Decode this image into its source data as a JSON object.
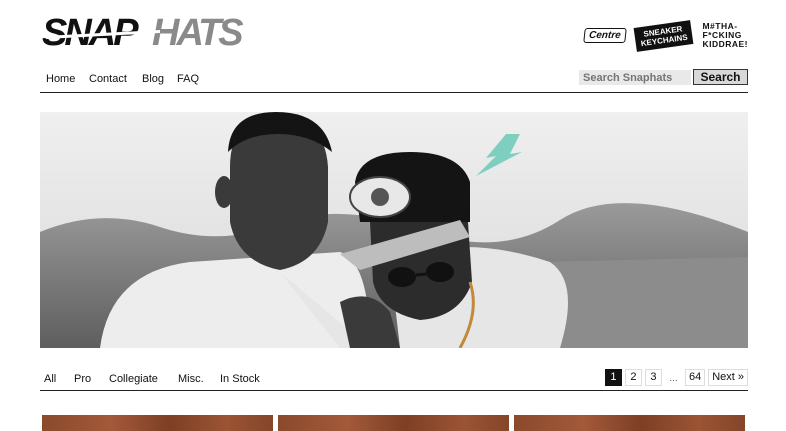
{
  "brand": {
    "logo_text_dark": "SNAP",
    "logo_text_light": "HATS"
  },
  "partners": {
    "centre": "Centre",
    "sneaker": [
      "SNEAKER",
      "KEYCHAINS"
    ],
    "kidd": [
      "M#THA-",
      "F*CKING",
      "KIDDRAE!"
    ]
  },
  "nav": {
    "items": [
      "Home",
      "Contact",
      "Blog",
      "FAQ"
    ]
  },
  "search": {
    "placeholder": "Search Snaphats",
    "button": "Search"
  },
  "filters": {
    "items": [
      "All",
      "Pro",
      "Collegiate",
      "Misc.",
      "In Stock"
    ]
  },
  "pagination": {
    "pages": [
      "1",
      "2",
      "3"
    ],
    "ellipsis": "...",
    "last": "64",
    "next": "Next »",
    "current": "1"
  },
  "colors": {
    "accent": "#7fcfc0",
    "logo_dark": "#111111",
    "logo_light": "#888888",
    "thumb": "#9a5535"
  }
}
